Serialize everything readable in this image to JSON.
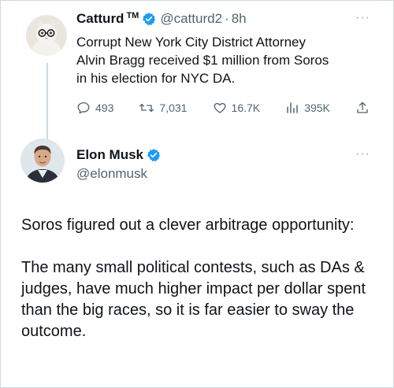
{
  "tweet1": {
    "display_name": "Catturd",
    "tm": "TM",
    "handle": "@catturd2",
    "dot": "·",
    "time": "8h",
    "more": "···",
    "lines": [
      "Corrupt New York City District Attorney",
      "Alvin Bragg received $1 million from Soros",
      "in his election for NYC DA."
    ],
    "stats": {
      "replies": "493",
      "retweets": "7,031",
      "likes": "16.7K",
      "views": "395K"
    }
  },
  "tweet2": {
    "display_name": "Elon Musk",
    "handle": "@elonmusk",
    "more": "···",
    "paragraphs": [
      "Soros figured out a clever arbitrage opportunity:",
      "The many small political contests, such as DAs & judges, have much higher impact per dollar spent than the big races, so it is far easier to sway the outcome."
    ]
  },
  "colors": {
    "verified_blue": "#1d9bf0",
    "muted_text": "#536471",
    "text": "#0f1419"
  },
  "icons": [
    "verified-icon",
    "reply-icon",
    "retweet-icon",
    "like-icon",
    "views-icon",
    "share-icon",
    "more-icon"
  ]
}
